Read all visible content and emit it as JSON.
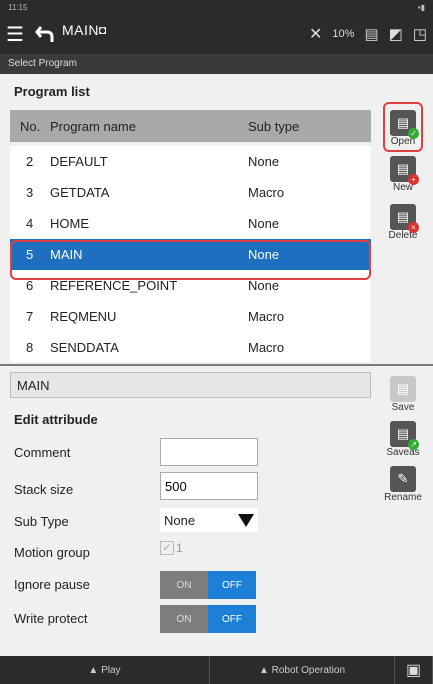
{
  "status": {
    "time": "11:15"
  },
  "titlebar": {
    "title": "MAIN",
    "percent": "10%"
  },
  "subtitle": "Select Program",
  "program_list": {
    "title": "Program list",
    "columns": [
      "No.",
      "Program name",
      "Sub type"
    ],
    "rows": [
      {
        "no": "2",
        "name": "DEFAULT",
        "type": "None"
      },
      {
        "no": "3",
        "name": "GETDATA",
        "type": "Macro"
      },
      {
        "no": "4",
        "name": "HOME",
        "type": "None"
      },
      {
        "no": "5",
        "name": "MAIN",
        "type": "None"
      },
      {
        "no": "6",
        "name": "REFERENCE_POINT",
        "type": "None"
      },
      {
        "no": "7",
        "name": "REQMENU",
        "type": "Macro"
      },
      {
        "no": "8",
        "name": "SENDDATA",
        "type": "Macro"
      }
    ]
  },
  "tools": {
    "open": "Open",
    "new": "New",
    "delete": "Delete",
    "save": "Save",
    "saveas": "Saveas",
    "rename": "Rename"
  },
  "edit": {
    "program_name": "MAIN",
    "title": "Edit attribude",
    "labels": {
      "comment": "Comment",
      "stack_size": "Stack size",
      "sub_type": "Sub Type",
      "motion_group": "Motion group",
      "ignore_pause": "Ignore pause",
      "write_protect": "Write protect"
    },
    "comment": "",
    "stack_size": "500",
    "sub_type": "None",
    "motion_group": "1",
    "on_label": "ON",
    "off_label": "OFF"
  },
  "bottombar": {
    "play": "▲ Play",
    "robot": "▲ Robot Operation"
  },
  "colors": {
    "selected": "#1e6fc0",
    "toggle_off": "#1e7fd6",
    "highlight": "#e04040"
  }
}
